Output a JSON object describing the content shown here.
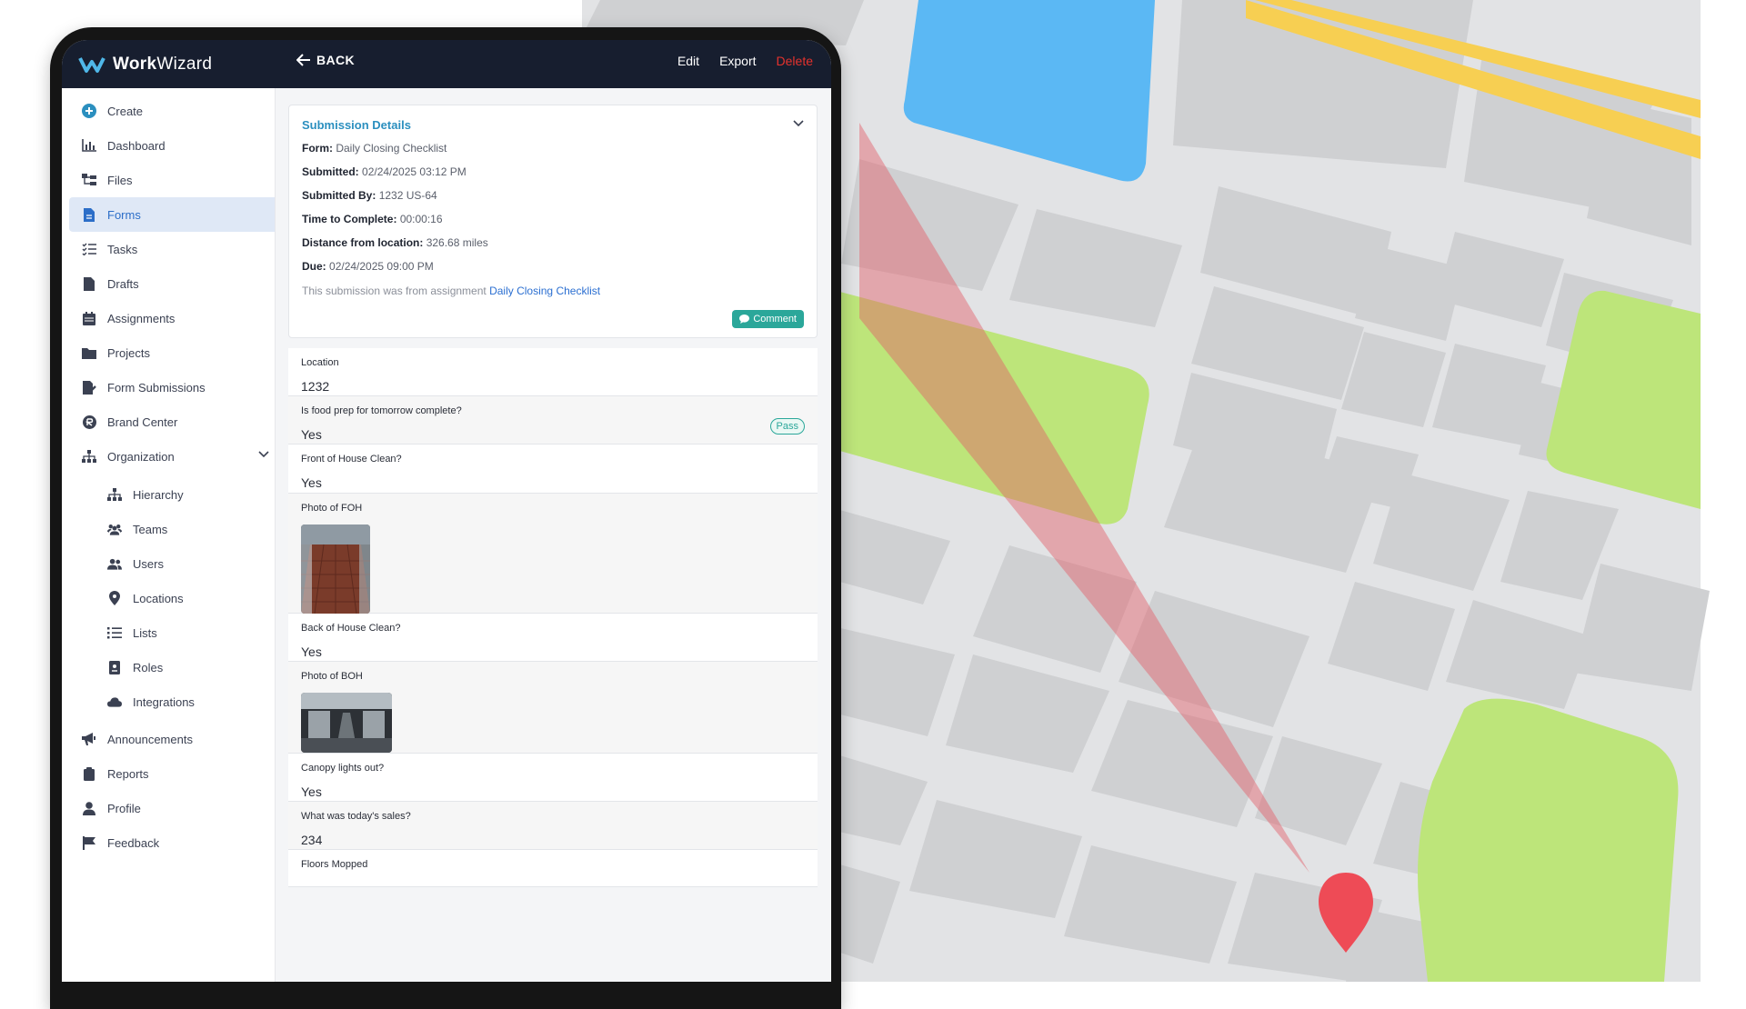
{
  "app": {
    "logo_bold": "Work",
    "logo_light": "Wizard"
  },
  "topbar": {
    "back_label": "BACK",
    "edit_label": "Edit",
    "export_label": "Export",
    "delete_label": "Delete"
  },
  "sidebar": {
    "items": [
      {
        "label": "Create",
        "icon": "plus-circle-icon"
      },
      {
        "label": "Dashboard",
        "icon": "bar-chart-icon"
      },
      {
        "label": "Files",
        "icon": "folder-tree-icon"
      },
      {
        "label": "Forms",
        "icon": "form-icon",
        "active": true
      },
      {
        "label": "Tasks",
        "icon": "tasks-icon"
      },
      {
        "label": "Drafts",
        "icon": "draft-icon"
      },
      {
        "label": "Assignments",
        "icon": "calendar-icon"
      },
      {
        "label": "Projects",
        "icon": "folder-icon"
      },
      {
        "label": "Form Submissions",
        "icon": "file-edit-icon"
      },
      {
        "label": "Brand Center",
        "icon": "brand-icon"
      },
      {
        "label": "Organization",
        "icon": "org-chart-icon"
      }
    ],
    "subitems": [
      {
        "label": "Hierarchy",
        "icon": "hierarchy-icon"
      },
      {
        "label": "Teams",
        "icon": "teams-icon"
      },
      {
        "label": "Users",
        "icon": "users-icon"
      },
      {
        "label": "Locations",
        "icon": "map-pin-icon"
      },
      {
        "label": "Lists",
        "icon": "list-icon"
      },
      {
        "label": "Roles",
        "icon": "id-badge-icon"
      },
      {
        "label": "Integrations",
        "icon": "cloud-icon"
      }
    ],
    "bottom_items": [
      {
        "label": "Announcements",
        "icon": "megaphone-icon"
      },
      {
        "label": "Reports",
        "icon": "clipboard-icon"
      },
      {
        "label": "Profile",
        "icon": "user-icon"
      },
      {
        "label": "Feedback",
        "icon": "flag-icon"
      }
    ]
  },
  "details": {
    "title": "Submission Details",
    "form_label": "Form:",
    "form_value": "Daily Closing Checklist",
    "submitted_label": "Submitted:",
    "submitted_value": "02/24/2025 03:12 PM",
    "submitted_by_label": "Submitted By:",
    "submitted_by_value": "1232 US-64",
    "time_label": "Time to Complete:",
    "time_value": "00:00:16",
    "distance_label": "Distance from location:",
    "distance_value": "326.68 miles",
    "due_label": "Due:",
    "due_value": "02/24/2025 09:00 PM",
    "note_prefix": "This submission was from assignment",
    "note_link": "Daily Closing Checklist",
    "comment_label": "Comment"
  },
  "answers": [
    {
      "question": "Location",
      "answer": "1232"
    },
    {
      "question": "Is food prep for tomorrow complete?",
      "answer": "Yes",
      "badge": "Pass"
    },
    {
      "question": "Front of House Clean?",
      "answer": "Yes"
    },
    {
      "question": "Photo of FOH",
      "photo": "foh-photo"
    },
    {
      "question": "Back of House Clean?",
      "answer": "Yes"
    },
    {
      "question": "Photo of BOH",
      "photo": "boh-photo"
    },
    {
      "question": "Canopy lights out?",
      "answer": "Yes"
    },
    {
      "question": "What was today's sales?",
      "answer": "234"
    },
    {
      "question": "Floors Mopped",
      "answer": ""
    }
  ],
  "colors": {
    "topbar": "#171e2f",
    "accent": "#2b8fbf",
    "teal": "#2ba79a",
    "danger": "#e5322d",
    "pin": "#ee4b56"
  }
}
